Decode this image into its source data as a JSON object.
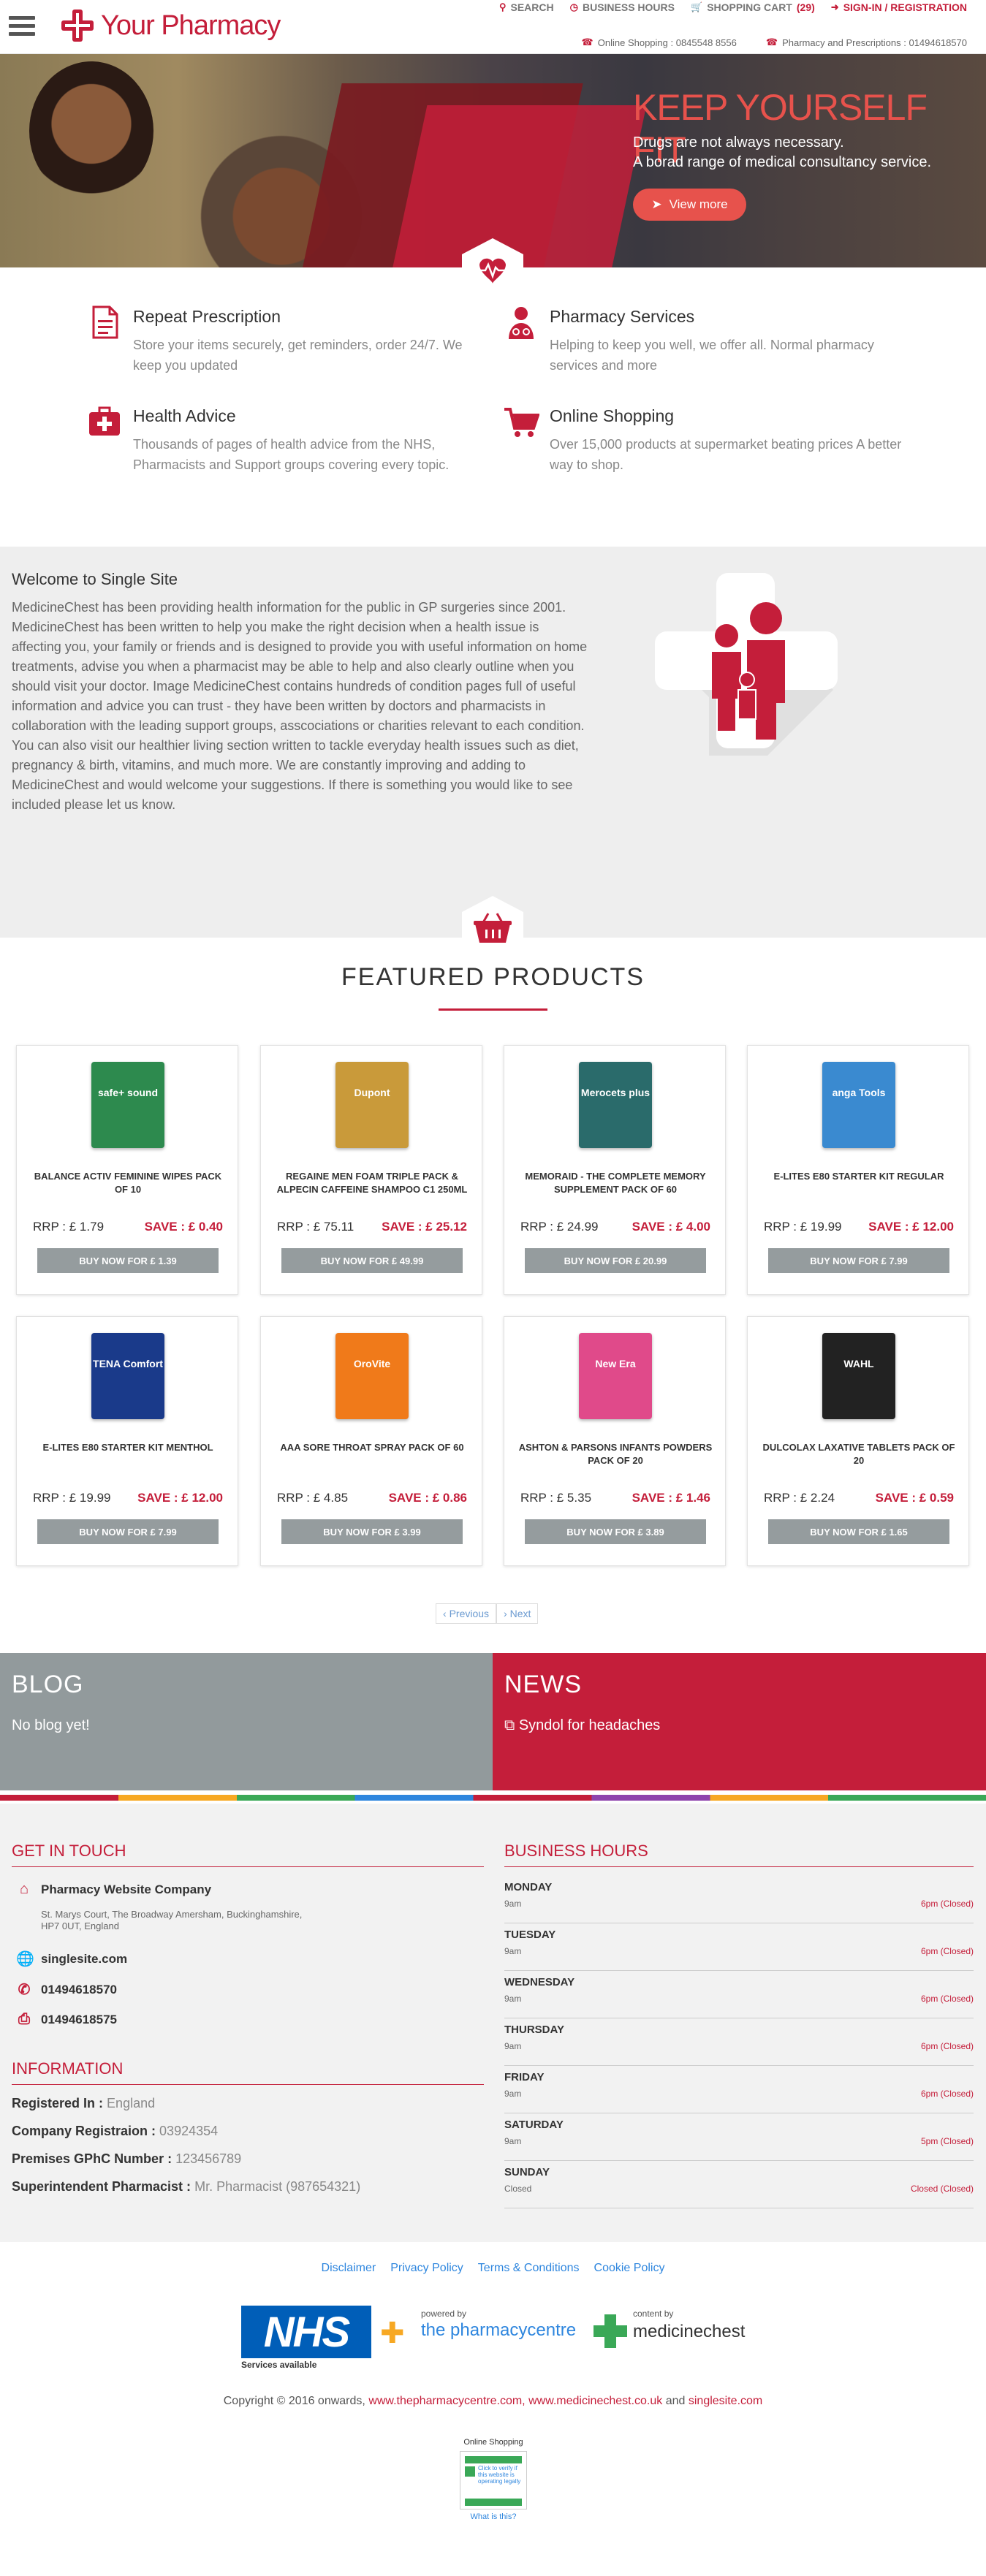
{
  "header": {
    "logo_text": "Your Pharmacy",
    "nav": [
      {
        "label": "SEARCH",
        "icon": "search-icon"
      },
      {
        "label": "BUSINESS HOURS",
        "icon": "clock-icon"
      },
      {
        "label": "SHOPPING CART",
        "count": "(29)",
        "icon": "cart-icon"
      },
      {
        "label": "SIGN-IN / REGISTRATION",
        "icon": "sign-in-icon"
      }
    ],
    "online_shopping": "Online Shopping : 0845548 8556",
    "pharmacy_phone": "Pharmacy and Prescriptions : 01494618570"
  },
  "hero": {
    "title": "KEEP YOURSELF FIT",
    "line1": "Drugs are not always necessary.",
    "line2": "A borad range of medical consultancy service.",
    "button": "View more"
  },
  "services": [
    {
      "title": "Repeat Prescription",
      "text": "Store your items securely, get reminders, order 24/7. We keep you updated",
      "icon": "prescription-icon"
    },
    {
      "title": "Pharmacy Services",
      "text": "Helping to keep you well, we offer all. Normal pharmacy services and more",
      "icon": "pharmacist-icon"
    },
    {
      "title": "Health Advice",
      "text": "Thousands of pages of health advice from the NHS, Pharmacists and Support groups covering every topic.",
      "icon": "medical-kit-icon"
    },
    {
      "title": "Online Shopping",
      "text": "Over 15,000 products at supermarket beating prices  A better way to shop.",
      "icon": "cart-icon"
    }
  ],
  "welcome": {
    "title": "Welcome to Single Site",
    "text": "MedicineChest has been providing health information for the public in GP surgeries since 2001. MedicineChest has been written to help you make the right decision when a health issue is affecting you, your family or friends and is designed to provide you with useful information on home treatments, advise you when a pharmacist may be able to help and also clearly outline when you should visit your doctor. Image MedicineChest contains hundreds of condition pages full of useful information and advice you can trust - they have been written by doctors and pharmacists in collaboration with the leading support groups, asscociations or charities relevant to each condition. You can also visit our healthier living section written to tackle everyday health issues such as diet, pregnancy & birth, vitamins, and much more. We are constantly improving and adding to MedicineChest and would welcome your suggestions. If there is something you would like to see included please let us know."
  },
  "featured": {
    "title": "FEATURED PRODUCTS",
    "products": [
      {
        "name": "BALANCE ACTIV FEMININE WIPES PACK OF 10",
        "rrp": "RRP : £ 1.79",
        "save": "SAVE : £ 0.40",
        "buy": "BUY NOW FOR £ 1.39"
      },
      {
        "name": "REGAINE MEN FOAM TRIPLE PACK & ALPECIN CAFFEINE SHAMPOO C1 250ML",
        "rrp": "RRP : £ 75.11",
        "save": "SAVE : £ 25.12",
        "buy": "BUY NOW FOR £ 49.99"
      },
      {
        "name": "MEMORAID - THE COMPLETE MEMORY SUPPLEMENT PACK OF 60",
        "rrp": "RRP : £ 24.99",
        "save": "SAVE : £ 4.00",
        "buy": "BUY NOW FOR £ 20.99"
      },
      {
        "name": "E-LITES E80 STARTER KIT REGULAR",
        "rrp": "RRP : £ 19.99",
        "save": "SAVE : £ 12.00",
        "buy": "BUY NOW FOR £ 7.99"
      },
      {
        "name": "E-LITES E80 STARTER KIT MENTHOL",
        "rrp": "RRP : £ 19.99",
        "save": "SAVE : £ 12.00",
        "buy": "BUY NOW FOR £ 7.99"
      },
      {
        "name": "AAA SORE THROAT SPRAY PACK OF 60",
        "rrp": "RRP : £ 4.85",
        "save": "SAVE : £ 0.86",
        "buy": "BUY NOW FOR £ 3.99"
      },
      {
        "name": "ASHTON & PARSONS INFANTS POWDERS PACK OF 20",
        "rrp": "RRP : £ 5.35",
        "save": "SAVE : £ 1.46",
        "buy": "BUY NOW FOR £ 3.89"
      },
      {
        "name": "DULCOLAX LAXATIVE TABLETS PACK OF 20",
        "rrp": "RRP : £ 2.24",
        "save": "SAVE : £ 0.59",
        "buy": "BUY NOW FOR £ 1.65"
      }
    ],
    "product_images": [
      {
        "label": "safe+ sound",
        "color": "#2d8a4e"
      },
      {
        "label": "Dupont",
        "color": "#c99a3a"
      },
      {
        "label": "Merocets plus",
        "color": "#2a6b6b"
      },
      {
        "label": "anga Tools",
        "color": "#3a8ad0"
      },
      {
        "label": "TENA Comfort",
        "color": "#1a3a8a"
      },
      {
        "label": "OroVite",
        "color": "#f07a1a"
      },
      {
        "label": "New Era",
        "color": "#e04a8a"
      },
      {
        "label": "WAHL",
        "color": "#222222"
      }
    ],
    "prev": "Previous",
    "next": "Next"
  },
  "blog": {
    "title": "BLOG",
    "text": "No blog yet!"
  },
  "news": {
    "title": "NEWS",
    "text": "Syndol for headaches"
  },
  "contact": {
    "title": "GET IN TOUCH",
    "company": "Pharmacy Website Company",
    "address_line1": "St. Marys Court, The Broadway Amersham, Buckinghamshire,",
    "address_line2": "HP7 0UT, England",
    "website": "singlesite.com",
    "phone": "01494618570",
    "fax": "01494618575"
  },
  "information": {
    "title": "INFORMATION",
    "rows": [
      {
        "label": "Registered In :",
        "value": "England"
      },
      {
        "label": "Company Registraion :",
        "value": "03924354"
      },
      {
        "label": "Premises GPhC Number :",
        "value": "123456789"
      },
      {
        "label": "Superintendent Pharmacist :",
        "value": "Mr. Pharmacist (987654321)"
      }
    ]
  },
  "hours": {
    "title": "BUSINESS HOURS",
    "days": [
      {
        "day": "MONDAY",
        "open": "9am",
        "close": "6pm (Closed)"
      },
      {
        "day": "TUESDAY",
        "open": "9am",
        "close": "6pm (Closed)"
      },
      {
        "day": "WEDNESDAY",
        "open": "9am",
        "close": "6pm (Closed)"
      },
      {
        "day": "THURSDAY",
        "open": "9am",
        "close": "6pm (Closed)"
      },
      {
        "day": "FRIDAY",
        "open": "9am",
        "close": "6pm (Closed)"
      },
      {
        "day": "SATURDAY",
        "open": "9am",
        "close": "5pm (Closed)"
      },
      {
        "day": "SUNDAY",
        "open": "Closed",
        "close": "Closed (Closed)"
      }
    ]
  },
  "footer_links": [
    "Disclaimer",
    "Privacy Policy",
    "Terms & Conditions",
    "Cookie Policy"
  ],
  "partners": {
    "nhs": "NHS",
    "nhs_sub": "Services available",
    "tpc_powered": "powered by",
    "tpc_name": "the pharmacycentre",
    "mc_powered": "content by",
    "mc_name": "medicinechest"
  },
  "copyright": {
    "prefix": "Copyright © 2016 onwards,",
    "link1": "www.thepharmacycentre.com,",
    "link2": "www.medicinechest.co.uk",
    "and": "and",
    "link3": "singlesite.com"
  },
  "registry": {
    "title": "Online Shopping",
    "badge_text": "Click to verify if this website is operating legally",
    "link": "What is this?"
  },
  "colors": {
    "brand": "#c41e3a",
    "accent": "#e7524c",
    "button_grey": "#959c9e"
  }
}
